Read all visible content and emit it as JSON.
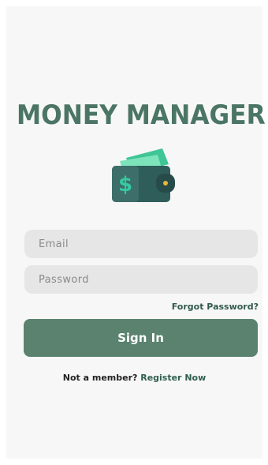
{
  "app": {
    "title": "MONEY MANAGER",
    "logo_icon": "wallet-dollar-icon"
  },
  "login_form": {
    "email_placeholder": "Email",
    "email_value": "",
    "password_placeholder": "Password",
    "password_value": "",
    "forgot_password_label": "Forgot Password?",
    "signin_label": "Sign In",
    "register_prompt": "Not a member?",
    "register_label": "Register Now"
  },
  "colors": {
    "brand_green": "#4b7565",
    "button_green": "#5a826f",
    "link_green": "#315a4c",
    "background": "#f7f7f7",
    "field_background": "#e6e6e6"
  }
}
